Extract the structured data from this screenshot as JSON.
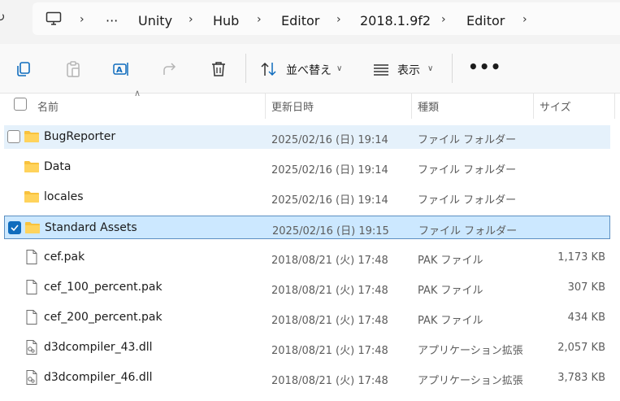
{
  "breadcrumb": {
    "items": [
      "Unity",
      "Hub",
      "Editor",
      "2018.1.9f2",
      "Editor"
    ],
    "overflow": "···"
  },
  "toolbar": {
    "sort_label": "並べ替え",
    "view_label": "表示",
    "more_label": "•••"
  },
  "columns": {
    "name": "名前",
    "modified": "更新日時",
    "type": "種類",
    "size": "サイズ"
  },
  "files": [
    {
      "name": "BugReporter",
      "modified": "2025/02/16 (日) 19:14",
      "type": "ファイル フォルダー",
      "size": "",
      "kind": "folder",
      "state": "hover"
    },
    {
      "name": "Data",
      "modified": "2025/02/16 (日) 19:14",
      "type": "ファイル フォルダー",
      "size": "",
      "kind": "folder",
      "state": "normal"
    },
    {
      "name": "locales",
      "modified": "2025/02/16 (日) 19:14",
      "type": "ファイル フォルダー",
      "size": "",
      "kind": "folder",
      "state": "normal"
    },
    {
      "name": "Standard Assets",
      "modified": "2025/02/16 (日) 19:15",
      "type": "ファイル フォルダー",
      "size": "",
      "kind": "folder",
      "state": "selected"
    },
    {
      "name": "cef.pak",
      "modified": "2018/08/21 (火) 17:48",
      "type": "PAK ファイル",
      "size": "1,173 KB",
      "kind": "file",
      "state": "normal"
    },
    {
      "name": "cef_100_percent.pak",
      "modified": "2018/08/21 (火) 17:48",
      "type": "PAK ファイル",
      "size": "307 KB",
      "kind": "file",
      "state": "normal"
    },
    {
      "name": "cef_200_percent.pak",
      "modified": "2018/08/21 (火) 17:48",
      "type": "PAK ファイル",
      "size": "434 KB",
      "kind": "file",
      "state": "normal"
    },
    {
      "name": "d3dcompiler_43.dll",
      "modified": "2018/08/21 (火) 17:48",
      "type": "アプリケーション拡張",
      "size": "2,057 KB",
      "kind": "dll",
      "state": "normal"
    },
    {
      "name": "d3dcompiler_46.dll",
      "modified": "2018/08/21 (火) 17:48",
      "type": "アプリケーション拡張",
      "size": "3,783 KB",
      "kind": "dll",
      "state": "normal"
    }
  ],
  "colors": {
    "accent": "#0f6cbd",
    "folder": "#f8c23d",
    "hover_bg": "#e5f1fb",
    "selected_bg": "#cce8ff"
  }
}
